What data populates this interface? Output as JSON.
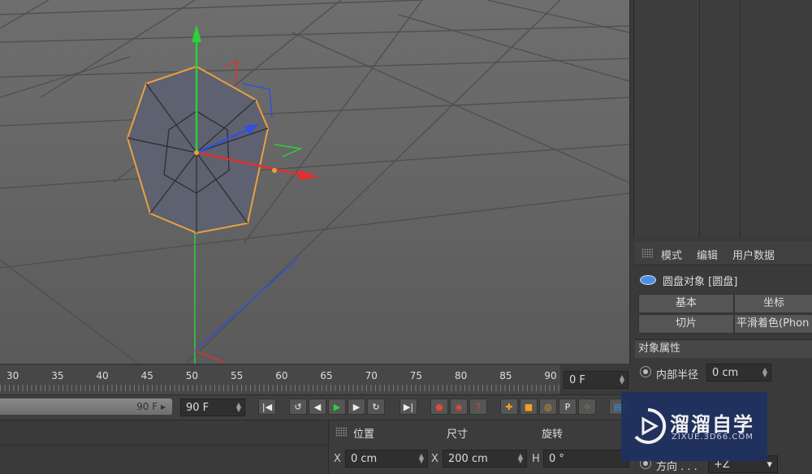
{
  "attributes_menu": {
    "mode": "模式",
    "edit": "编辑",
    "user_data": "用户数据"
  },
  "object": {
    "title": "圆盘对象 [圆盘]"
  },
  "tabs": {
    "basic": "基本",
    "coord": "坐标",
    "slice": "切片",
    "phong": "平滑着色(Phon"
  },
  "props": {
    "header": "对象属性",
    "inner_radius_label": "内部半径",
    "inner_radius_value": "0 cm",
    "direction_label": "方向 . . .",
    "direction_value": "+Z"
  },
  "timeline": {
    "ticks": [
      "30",
      "35",
      "40",
      "45",
      "50",
      "55",
      "60",
      "65",
      "70",
      "75",
      "80",
      "85",
      "90"
    ],
    "current_frame": "0 F",
    "range_end": "90 F",
    "end_frame": "90 F"
  },
  "coords": {
    "position_label": "位置",
    "size_label": "尺寸",
    "rotation_label": "旋转",
    "x_label": "X",
    "x_pos": "0 cm",
    "x_size": "200 cm",
    "h_label": "H",
    "h_rot": "0 °"
  },
  "watermark": {
    "title": "溜溜自学",
    "subtitle": "ZIXUE.3D66.COM"
  },
  "colors": {
    "x_axis": "#e03030",
    "y_axis": "#2ecf3a",
    "z_axis": "#3050e0",
    "selection": "#e8a040",
    "watermark_bg": "#1f3160"
  }
}
